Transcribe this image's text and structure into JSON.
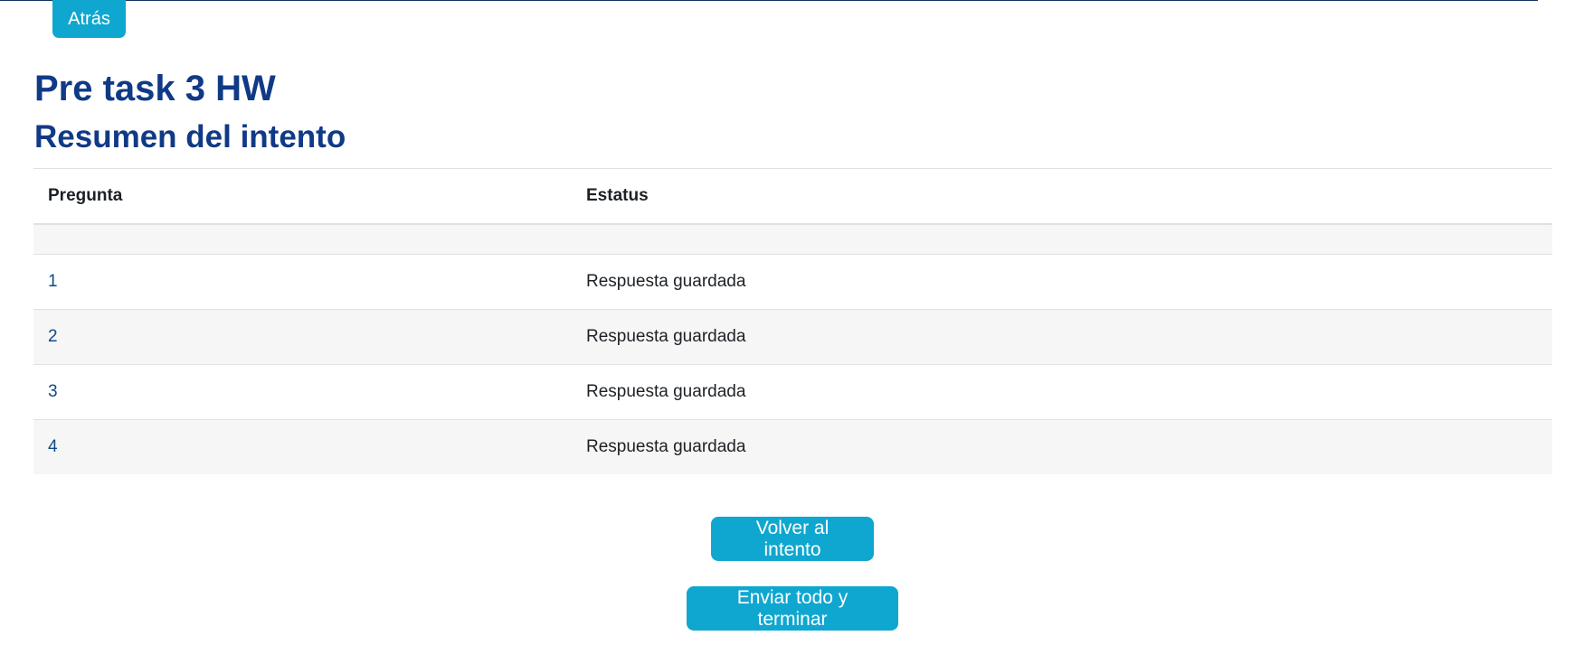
{
  "nav": {
    "back_label": "Atrás"
  },
  "page": {
    "title": "Pre task 3 HW",
    "section_title": "Resumen del intento"
  },
  "table": {
    "headers": {
      "question": "Pregunta",
      "status": "Estatus"
    },
    "rows": [
      {
        "question": "1",
        "status": "Respuesta guardada"
      },
      {
        "question": "2",
        "status": "Respuesta guardada"
      },
      {
        "question": "3",
        "status": "Respuesta guardada"
      },
      {
        "question": "4",
        "status": "Respuesta guardada"
      }
    ]
  },
  "actions": {
    "return_label": "Volver al intento",
    "submit_label": "Enviar todo y terminar"
  },
  "colors": {
    "accent": "#0fa7d0",
    "heading": "#103a86",
    "link": "#0f4a86",
    "stripe": "#f6f6f6"
  }
}
